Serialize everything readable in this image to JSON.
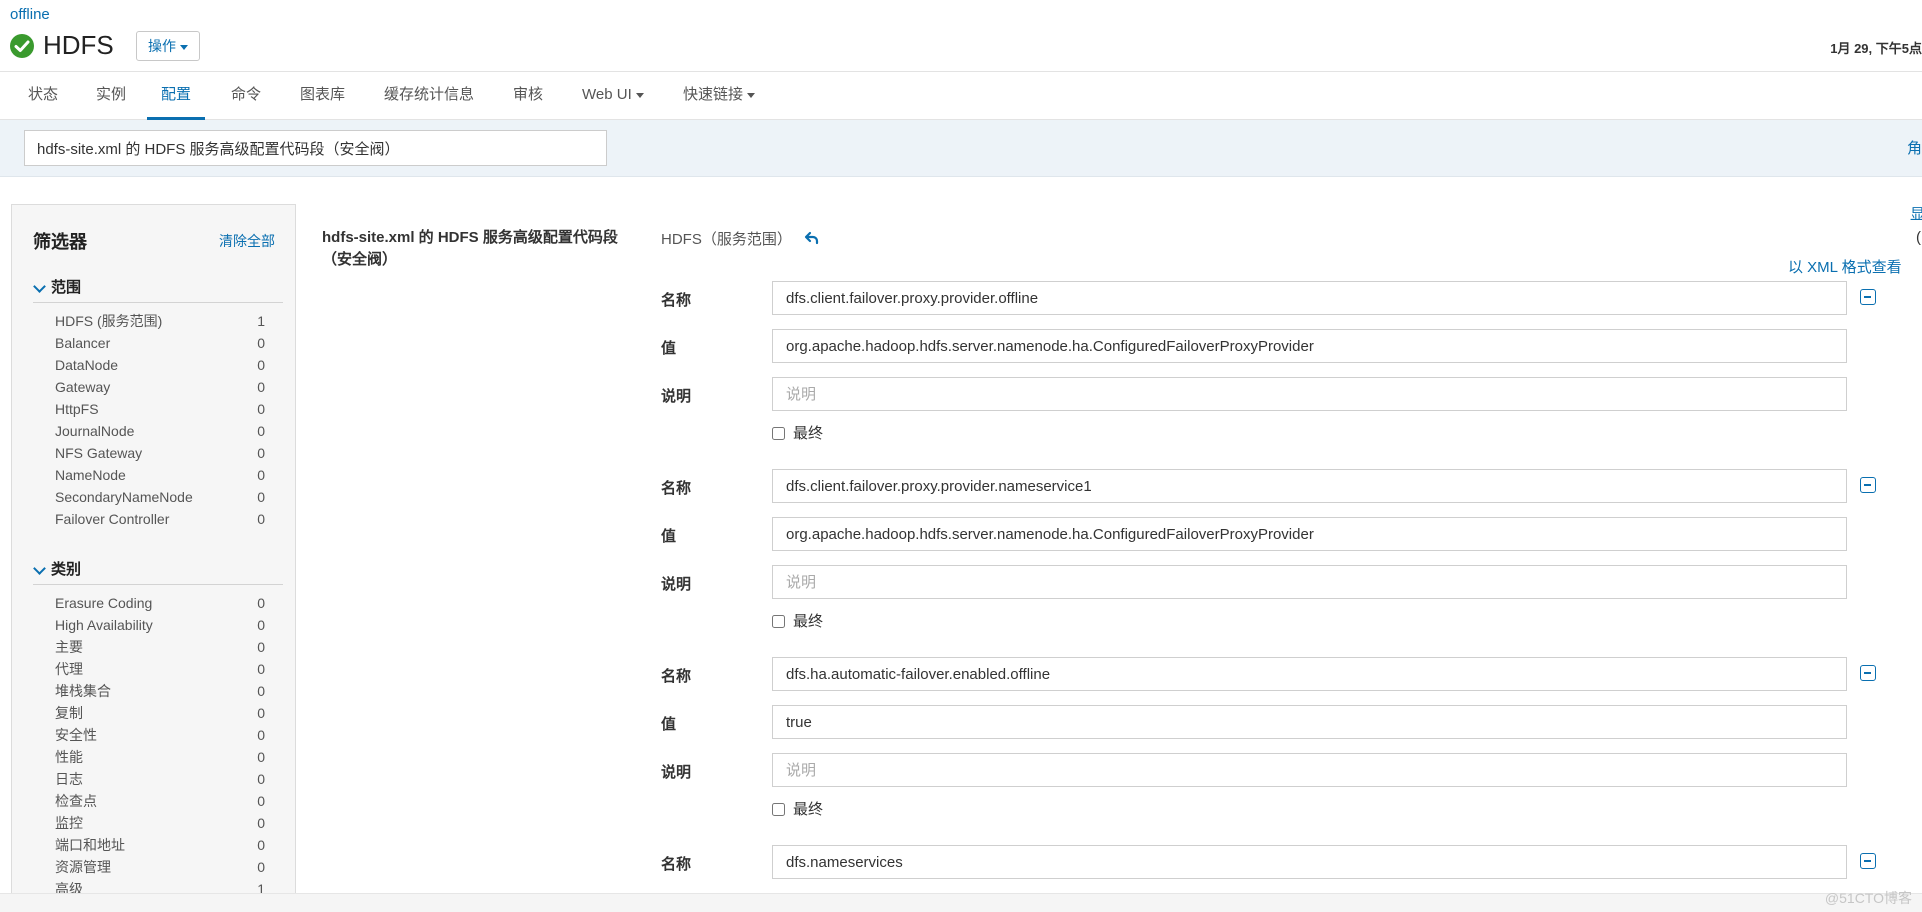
{
  "header": {
    "cluster_link": "offline",
    "service_title": "HDFS",
    "actions_label": "操作",
    "timestamp": "1月 29, 下午5点"
  },
  "tabs": [
    {
      "label": "状态",
      "active": false
    },
    {
      "label": "实例",
      "active": false
    },
    {
      "label": "配置",
      "active": true
    },
    {
      "label": "命令",
      "active": false
    },
    {
      "label": "图表库",
      "active": false
    },
    {
      "label": "缓存统计信息",
      "active": false
    },
    {
      "label": "审核",
      "active": false
    },
    {
      "label": "Web UI",
      "active": false,
      "dropdown": true
    },
    {
      "label": "快速链接",
      "active": false,
      "dropdown": true
    }
  ],
  "search": {
    "value": "hdfs-site.xml 的 HDFS 服务高级配置代码段（安全阀）",
    "right_text": "角"
  },
  "filters": {
    "title": "筛选器",
    "clear_all": "清除全部",
    "scope": {
      "heading": "范围",
      "items": [
        {
          "label": "HDFS (服务范围)",
          "count": "1"
        },
        {
          "label": "Balancer",
          "count": "0"
        },
        {
          "label": "DataNode",
          "count": "0"
        },
        {
          "label": "Gateway",
          "count": "0"
        },
        {
          "label": "HttpFS",
          "count": "0"
        },
        {
          "label": "JournalNode",
          "count": "0"
        },
        {
          "label": "NFS Gateway",
          "count": "0"
        },
        {
          "label": "NameNode",
          "count": "0"
        },
        {
          "label": "SecondaryNameNode",
          "count": "0"
        },
        {
          "label": "Failover Controller",
          "count": "0"
        }
      ]
    },
    "category": {
      "heading": "类别",
      "items": [
        {
          "label": "Erasure Coding",
          "count": "0"
        },
        {
          "label": "High Availability",
          "count": "0"
        },
        {
          "label": "主要",
          "count": "0"
        },
        {
          "label": "代理",
          "count": "0"
        },
        {
          "label": "堆栈集合",
          "count": "0"
        },
        {
          "label": "复制",
          "count": "0"
        },
        {
          "label": "安全性",
          "count": "0"
        },
        {
          "label": "性能",
          "count": "0"
        },
        {
          "label": "日志",
          "count": "0"
        },
        {
          "label": "检查点",
          "count": "0"
        },
        {
          "label": "监控",
          "count": "0"
        },
        {
          "label": "端口和地址",
          "count": "0"
        },
        {
          "label": "资源管理",
          "count": "0"
        },
        {
          "label": "高级",
          "count": "1"
        }
      ]
    }
  },
  "property": {
    "label": "hdfs-site.xml 的 HDFS 服务高级配置代码段（安全阀）",
    "scope": "HDFS（服务范围）",
    "xml_link": "以 XML 格式查看",
    "edge_link": "显",
    "edge_paren": "(",
    "name_label": "名称",
    "value_label": "值",
    "desc_label": "说明",
    "desc_placeholder": "说明",
    "final_label": "最终",
    "entries": [
      {
        "name": "dfs.client.failover.proxy.provider.offline",
        "value": "org.apache.hadoop.hdfs.server.namenode.ha.ConfiguredFailoverProxyProvider",
        "description": "",
        "final": false
      },
      {
        "name": "dfs.client.failover.proxy.provider.nameservice1",
        "value": "org.apache.hadoop.hdfs.server.namenode.ha.ConfiguredFailoverProxyProvider",
        "description": "",
        "final": false
      },
      {
        "name": "dfs.ha.automatic-failover.enabled.offline",
        "value": "true",
        "description": "",
        "final": false
      },
      {
        "name": "dfs.nameservices",
        "value": "",
        "description": "",
        "final": false
      }
    ]
  },
  "watermark": "@51CTO博客",
  "colors": {
    "accent": "#0a6fb0",
    "status_ok": "#3a9a2e",
    "band": "#edf3f8"
  }
}
